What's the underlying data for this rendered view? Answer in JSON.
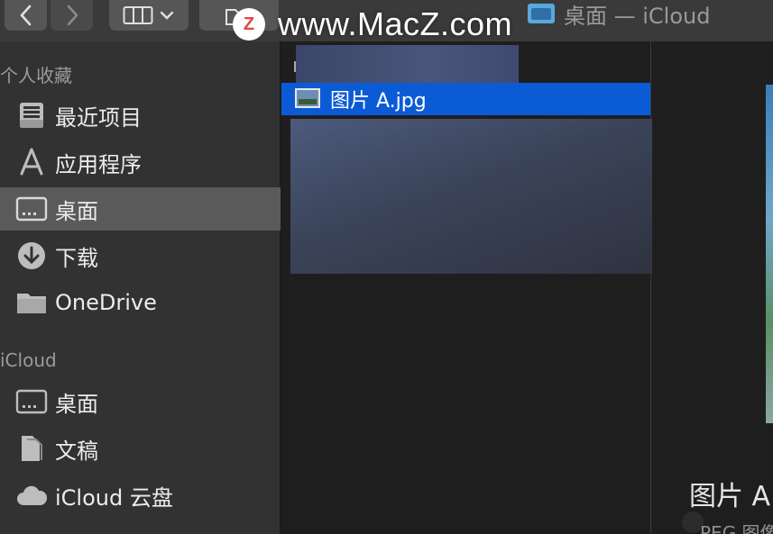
{
  "watermark": {
    "logo_letter": "Z",
    "text": "www.MacZ.com"
  },
  "window": {
    "title": "桌面 — iCloud"
  },
  "toolbar": {
    "back_icon": "chevron-left-icon",
    "forward_icon": "chevron-right-icon",
    "view_icon": "column-view-icon",
    "new_folder_icon": "new-folder-icon"
  },
  "sidebar": {
    "favorites_header": "个人收藏",
    "favorites": [
      {
        "label": "最近项目",
        "icon": "recents-icon"
      },
      {
        "label": "应用程序",
        "icon": "applications-icon"
      },
      {
        "label": "桌面",
        "icon": "desktop-icon",
        "selected": true
      },
      {
        "label": "下载",
        "icon": "downloads-icon"
      },
      {
        "label": "OneDrive",
        "icon": "folder-icon"
      }
    ],
    "icloud_header": "iCloud",
    "icloud": [
      {
        "label": "桌面",
        "icon": "desktop-icon"
      },
      {
        "label": "文稿",
        "icon": "documents-icon"
      },
      {
        "label": "iCloud 云盘",
        "icon": "cloud-icon"
      }
    ]
  },
  "column": {
    "selected_file": "图片 A.jpg"
  },
  "preview": {
    "name": "图片 A",
    "kind": "PEG 图像"
  },
  "colors": {
    "selection": "#0b5bd6",
    "sidebar_bg": "#323232",
    "sidebar_selected": "#5a5a5a",
    "window_bg": "#1e1e1e",
    "toolbar_bg": "#3a3a3a"
  }
}
